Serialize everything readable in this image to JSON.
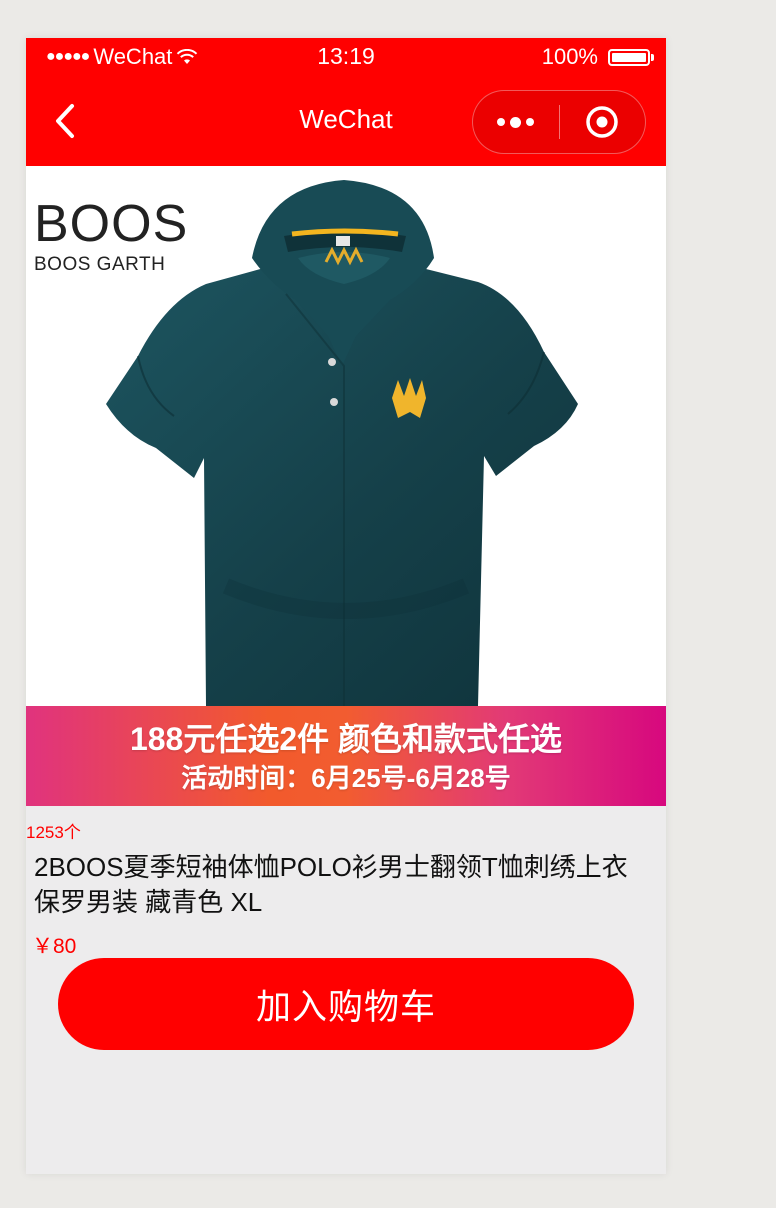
{
  "status_bar": {
    "signal": "●●●●●",
    "carrier": "WeChat",
    "time": "13:19",
    "battery": "100%"
  },
  "nav": {
    "title": "WeChat",
    "back_icon": "chevron-left-icon",
    "more_icon": "more-dots-icon",
    "close_icon": "target-circle-icon"
  },
  "product": {
    "image": {
      "brand": "BOOS",
      "brand_sub": "BOOS GARTH",
      "shirt_color": "#17474f"
    },
    "promo": {
      "line1": "188元任选2件 颜色和款式任选",
      "line2": "活动时间：6月25号-6月28号"
    },
    "sold_count": "1253个",
    "title": "2BOOS夏季短袖体恤POLO衫男士翻领T恤刺绣上衣保罗男装 藏青色 XL",
    "price": "￥80",
    "add_to_cart_label": "加入购物车"
  },
  "colors": {
    "accent": "#ff0000",
    "background": "#edeced"
  }
}
